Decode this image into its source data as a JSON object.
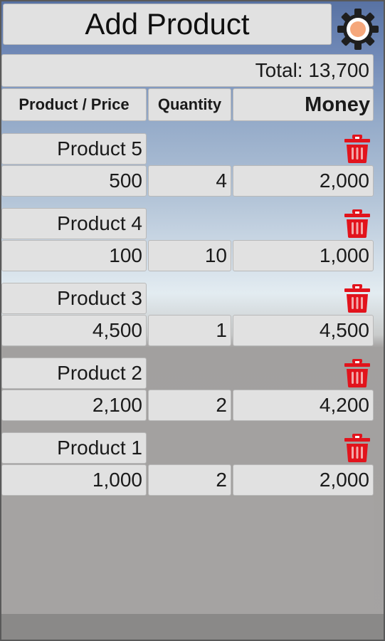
{
  "header": {
    "title": "Add Product"
  },
  "settings": {
    "icon": "gear-icon",
    "gear_color": "#1e1e1e",
    "center_color": "#f5a77b"
  },
  "summary": {
    "total_label": "Total: 13,700"
  },
  "columns": {
    "product_price": "Product / Price",
    "quantity": "Quantity",
    "money": "Money"
  },
  "colors": {
    "delete_icon": "#e2131c",
    "tile_background": "#e1e1e1"
  },
  "products": [
    {
      "name": "Product 5",
      "price": "500",
      "quantity": "4",
      "money": "2,000"
    },
    {
      "name": "Product 4",
      "price": "100",
      "quantity": "10",
      "money": "1,000"
    },
    {
      "name": "Product 3",
      "price": "4,500",
      "quantity": "1",
      "money": "4,500"
    },
    {
      "name": "Product 2",
      "price": "2,100",
      "quantity": "2",
      "money": "4,200"
    },
    {
      "name": "Product 1",
      "price": "1,000",
      "quantity": "2",
      "money": "2,000"
    }
  ]
}
